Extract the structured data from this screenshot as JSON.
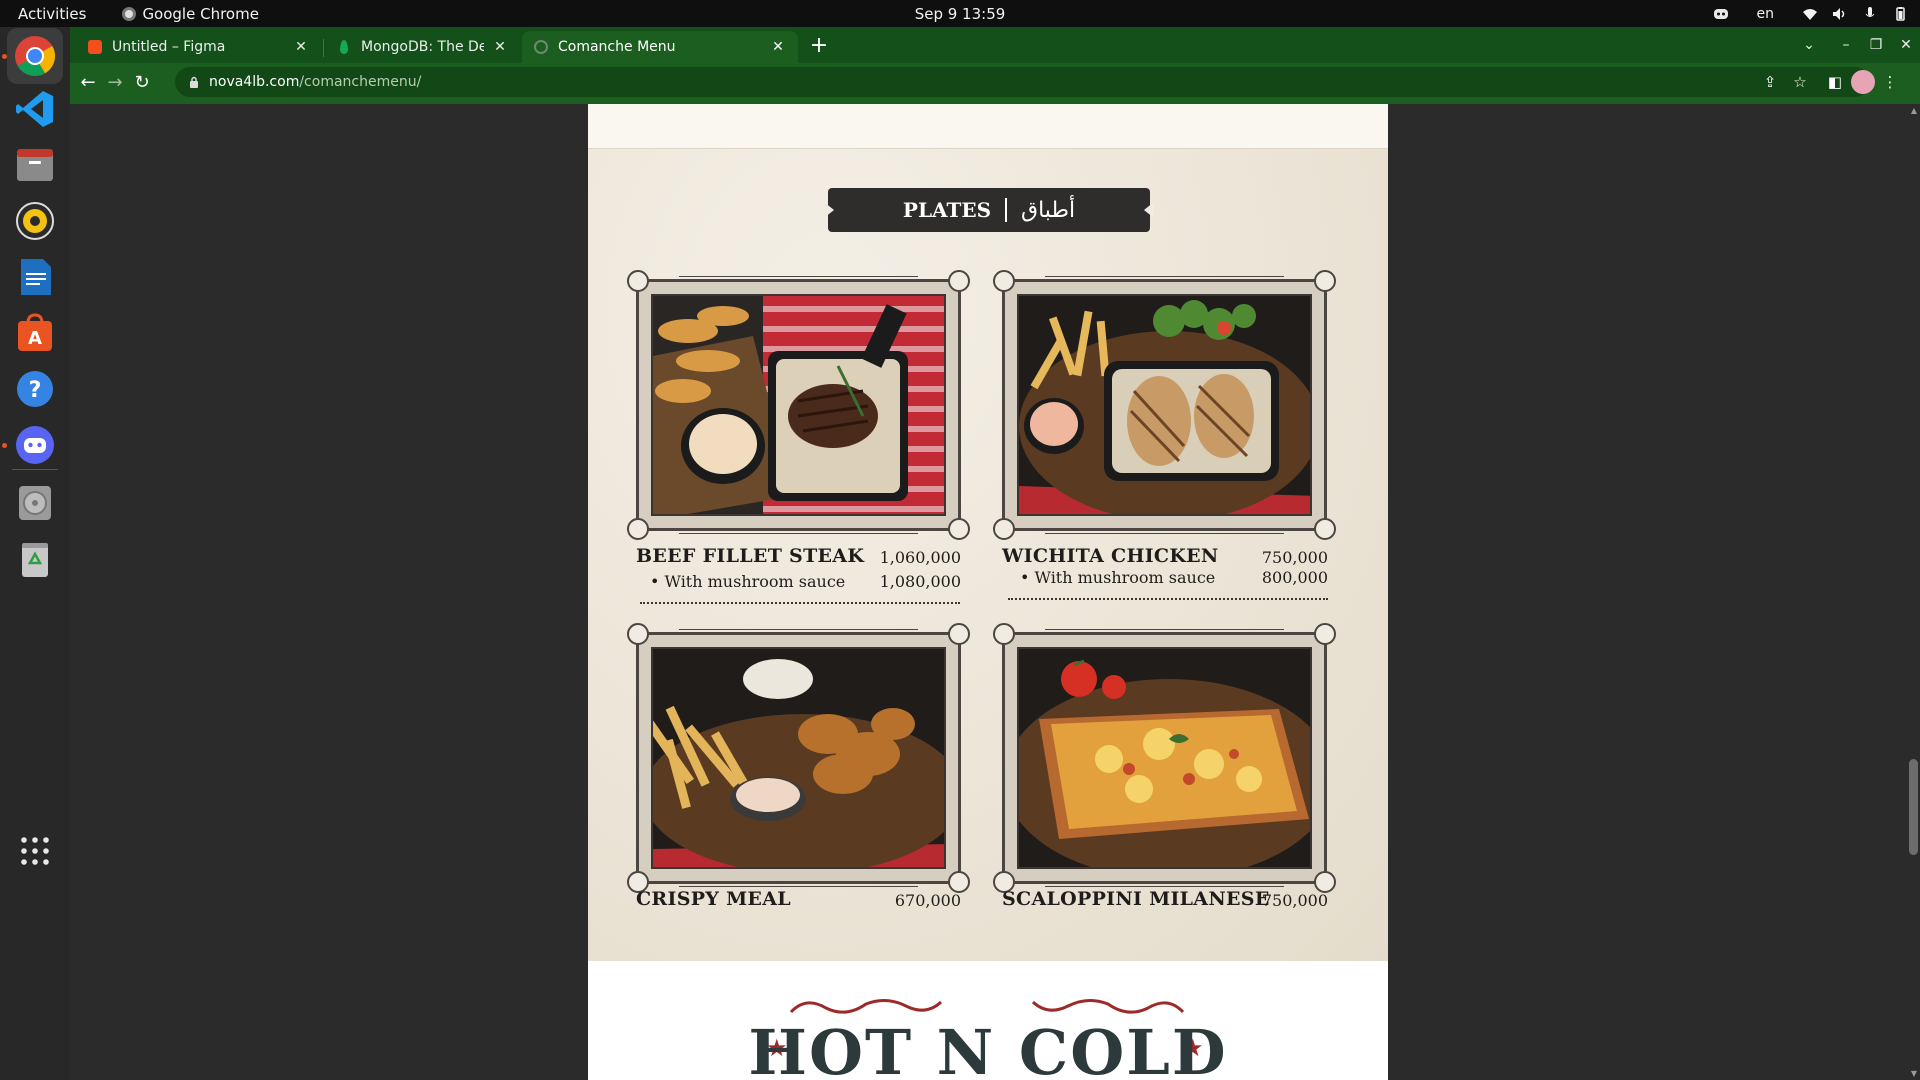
{
  "topbar": {
    "activities": "Activities",
    "app_name": "Google Chrome",
    "clock": "Sep 9  13:59",
    "lang": "en"
  },
  "dock": {
    "items": [
      "Google Chrome",
      "Visual Studio Code",
      "Files",
      "Rhythmbox",
      "LibreOffice Writer",
      "Ubuntu Software",
      "Help",
      "Discord",
      "Disks",
      "Trash",
      "Show Applications"
    ]
  },
  "browser": {
    "tabs": [
      {
        "title": "Untitled – Figma",
        "favicon_color": "#f24e1e"
      },
      {
        "title": "MongoDB: The Developer",
        "favicon_color": "#13aa52"
      },
      {
        "title": "Comanche Menu",
        "favicon_color": "#6c8a6e"
      }
    ],
    "active_tab": 2,
    "url_host": "nova4lb.com",
    "url_path": "/comanchemenu/",
    "accent": "#1b5e20"
  },
  "menu": {
    "section_en": "PLATES",
    "section_ar": "أطباق",
    "items": [
      {
        "name": "BEEF FILLET STEAK",
        "price": "1,060,000",
        "sub": "• With mushroom sauce",
        "sub_price": "1,080,000"
      },
      {
        "name": "WICHITA CHICKEN",
        "price": "750,000",
        "sub": "• With mushroom sauce",
        "sub_price": "800,000"
      },
      {
        "name": "CRISPY MEAL",
        "price": "670,000"
      },
      {
        "name": "SCALOPPINI MILANESE",
        "price": "750,000"
      }
    ],
    "next_section": "HOT N COLD"
  }
}
